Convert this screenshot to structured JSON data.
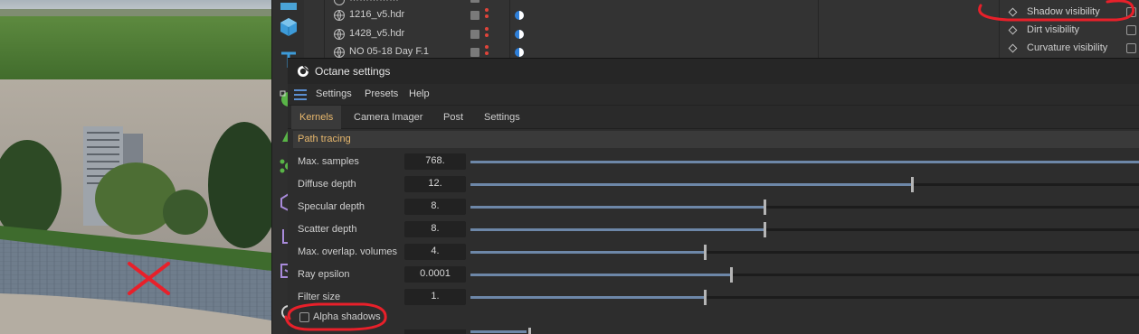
{
  "object_manager": {
    "items": [
      {
        "name": "1216_v5.hdr"
      },
      {
        "name": "1428_v5.hdr"
      },
      {
        "name": "NO 05-18  Day  F.1"
      }
    ],
    "visibility_options": [
      {
        "label": "Shadow visibility",
        "checked": false
      },
      {
        "label": "Dirt visibility",
        "checked": false
      },
      {
        "label": "Curvature visibility",
        "checked": false
      }
    ]
  },
  "octane": {
    "title": "Octane settings",
    "menu": [
      "Settings",
      "Presets",
      "Help"
    ],
    "tabs": [
      {
        "label": "Kernels",
        "active": true
      },
      {
        "label": "Camera Imager",
        "active": false
      },
      {
        "label": "Post",
        "active": false
      },
      {
        "label": "Settings",
        "active": false
      }
    ],
    "section": "Path tracing",
    "params": [
      {
        "label": "Max. samples",
        "value": "768.",
        "fraction": 1.0
      },
      {
        "label": "Diffuse depth",
        "value": "12.",
        "fraction": 0.66
      },
      {
        "label": "Specular depth",
        "value": "8.",
        "fraction": 0.44
      },
      {
        "label": "Scatter depth",
        "value": "8.",
        "fraction": 0.44
      },
      {
        "label": "Max. overlap. volumes",
        "value": "4.",
        "fraction": 0.35
      },
      {
        "label": "Ray epsilon",
        "value": "0.0001",
        "fraction": 0.39
      },
      {
        "label": "Filter size",
        "value": "1.",
        "fraction": 0.35
      }
    ],
    "alpha_shadows": {
      "label": "Alpha shadows",
      "checked": false
    }
  },
  "colors": {
    "accent_tab": "#e8b86d",
    "slider_fill": "#6d87a8",
    "annotation_red": "#e8202a"
  },
  "icons": [
    "cube-icon",
    "text-tool-icon",
    "spline-icon",
    "octane-logo-icon",
    "hamburger-icon",
    "environment-icon"
  ]
}
